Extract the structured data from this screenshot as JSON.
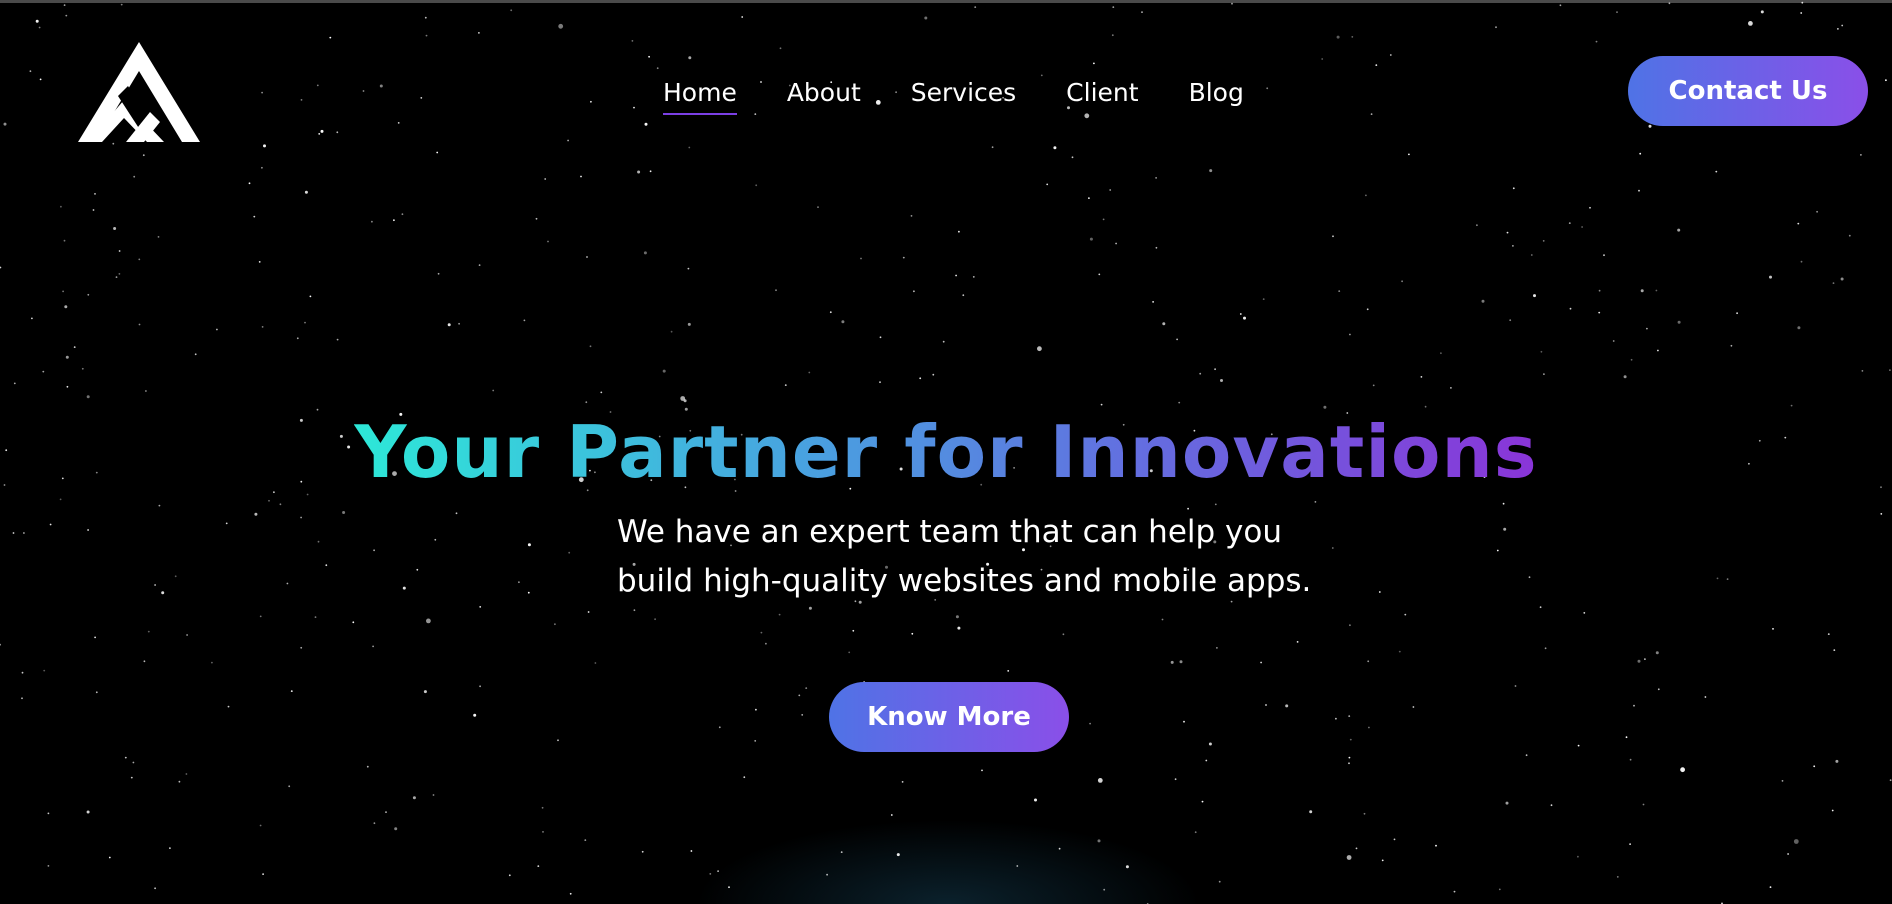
{
  "brand": {
    "logo_icon": "mountain-logo-icon"
  },
  "nav": {
    "items": [
      {
        "label": "Home",
        "active": true
      },
      {
        "label": "About",
        "active": false
      },
      {
        "label": "Services",
        "active": false
      },
      {
        "label": "Client",
        "active": false
      },
      {
        "label": "Blog",
        "active": false
      }
    ]
  },
  "header": {
    "contact_label": "Contact Us"
  },
  "hero": {
    "title": "Your Partner for Innovations",
    "subtitle_line1": "We have an expert team that can help you",
    "subtitle_line2": "build high-quality websites and mobile apps.",
    "cta_label": "Know More"
  },
  "colors": {
    "background": "#000000",
    "accent_start": "#4f73e6",
    "accent_end": "#8a4fe8",
    "title_gradient_start": "#2de8d8",
    "title_gradient_end": "#8a34d8",
    "nav_active_underline": "#7b3fe4"
  }
}
